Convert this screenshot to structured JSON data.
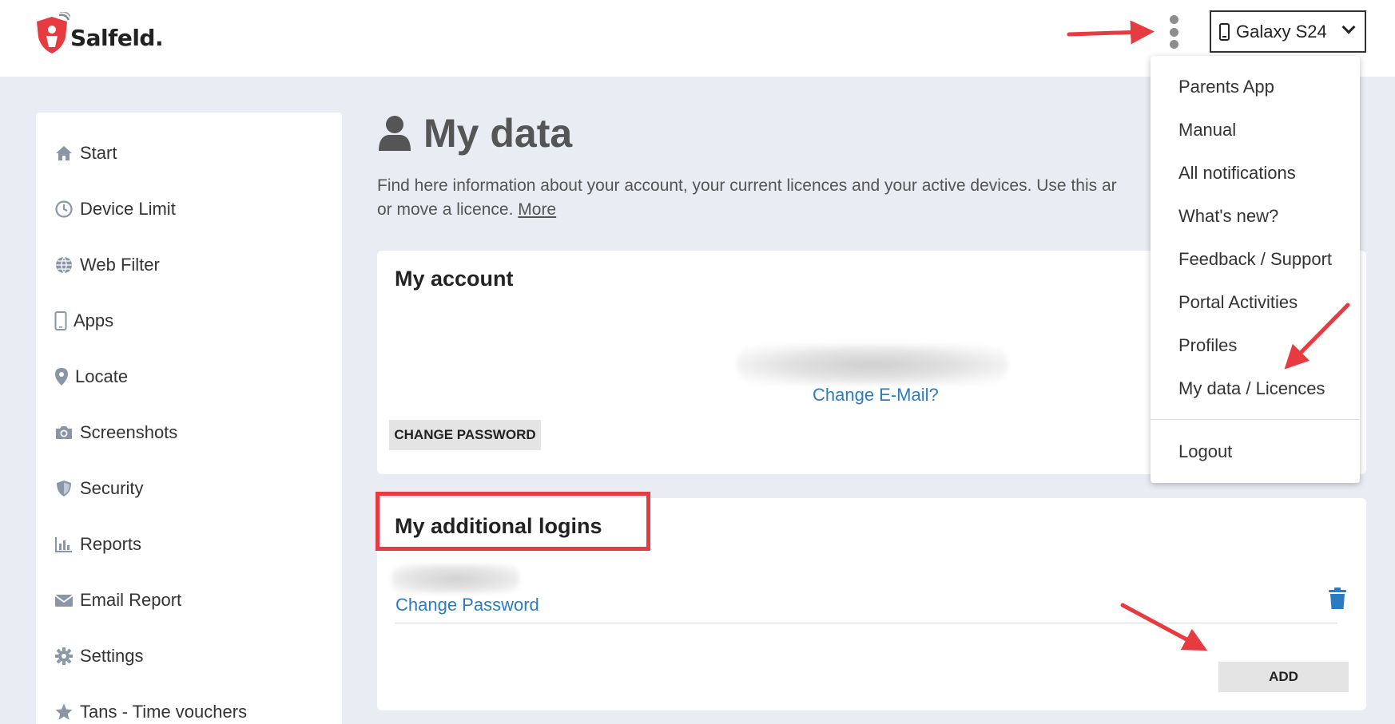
{
  "brand": {
    "name": "Salfeld.",
    "accent": "#e63b41"
  },
  "header": {
    "menu_icon": "kebab-icon",
    "device_selector": {
      "value": "Galaxy S24"
    }
  },
  "sidebar": {
    "items": [
      {
        "label": "Start",
        "icon": "home-icon"
      },
      {
        "label": "Device Limit",
        "icon": "clock-icon"
      },
      {
        "label": "Web Filter",
        "icon": "globe-icon"
      },
      {
        "label": "Apps",
        "icon": "phone-icon"
      },
      {
        "label": "Locate",
        "icon": "map-pin-icon"
      },
      {
        "label": "Screenshots",
        "icon": "camera-icon"
      },
      {
        "label": "Security",
        "icon": "shield-icon"
      },
      {
        "label": "Reports",
        "icon": "bar-chart-icon"
      },
      {
        "label": "Email Report",
        "icon": "envelope-icon"
      },
      {
        "label": "Settings",
        "icon": "gear-icon"
      },
      {
        "label": "Tans - Time vouchers",
        "icon": "star-icon"
      }
    ]
  },
  "main": {
    "title": "My data",
    "intro_line1": "Find here information about your account, your current licences and your active devices. Use this ar",
    "intro_line2": "or move a licence.",
    "intro_more": "More",
    "account": {
      "title": "My account",
      "change_email": "Change E-Mail?",
      "change_password": "CHANGE PASSWORD"
    },
    "additional_logins": {
      "title": "My additional logins",
      "change_password_link": "Change Password",
      "add_button": "ADD"
    }
  },
  "dropdown": {
    "items": [
      "Parents App",
      "Manual",
      "All notifications",
      "What's new?",
      "Feedback / Support",
      "Portal Activities",
      "Profiles",
      "My data / Licences"
    ],
    "logout": "Logout"
  },
  "colors": {
    "link": "#2b7bc0",
    "annotation": "#e63b41",
    "background": "#e9ecf3"
  }
}
